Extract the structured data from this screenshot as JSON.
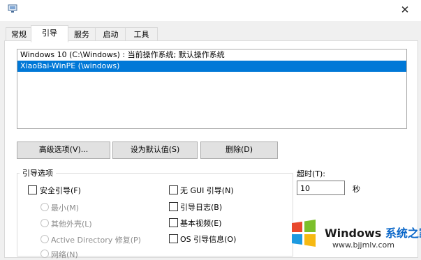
{
  "window": {
    "close_glyph": "✕",
    "app_icon": "system-config-icon"
  },
  "tabs": [
    {
      "label": "常规"
    },
    {
      "label": "引导",
      "active": true
    },
    {
      "label": "服务"
    },
    {
      "label": "启动"
    },
    {
      "label": "工具"
    }
  ],
  "os_list": [
    {
      "label": "Windows 10 (C:\\Windows) : 当前操作系统; 默认操作系统",
      "selected": false
    },
    {
      "label": "XiaoBai-WinPE (\\windows)",
      "selected": true
    }
  ],
  "buttons": {
    "advanced": "高级选项(V)...",
    "set_default": "设为默认值(S)",
    "delete": "删除(D)"
  },
  "boot_options": {
    "title": "引导选项",
    "safe_boot": "安全引导(F)",
    "minimal": "最小(M)",
    "alternate_shell": "其他外壳(L)",
    "active_directory": "Active Directory 修复(P)",
    "network": "网络(N)",
    "no_gui": "无 GUI 引导(N)",
    "boot_log": "引导日志(B)",
    "base_video": "基本视频(E)",
    "os_info": "OS 引导信息(O)"
  },
  "timeout": {
    "label": "超时(T):",
    "value": "10",
    "unit": "秒"
  },
  "watermark": {
    "title_a": "Windows ",
    "title_b": "系统之家",
    "url": "www.bjjmlv.com"
  },
  "colors": {
    "selection": "#0078d7",
    "button_bg": "#e1e1e1",
    "watermark_accent": "#0a67c9"
  }
}
